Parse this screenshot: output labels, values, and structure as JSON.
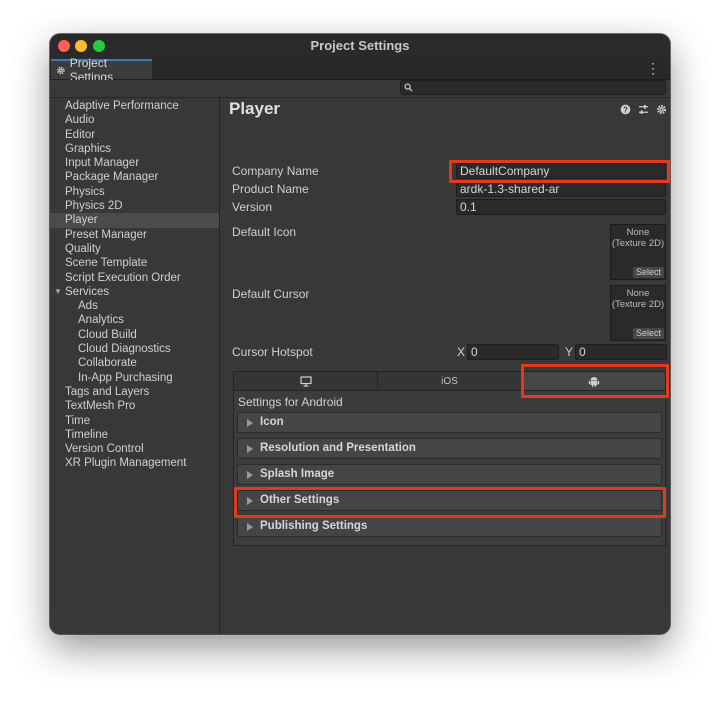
{
  "window": {
    "title": "Project Settings"
  },
  "tab": {
    "label": "Project Settings",
    "icon": "gear-icon"
  },
  "search": {
    "placeholder": "",
    "icon": "search-icon"
  },
  "sidebar": {
    "items": [
      {
        "label": "Adaptive Performance"
      },
      {
        "label": "Audio"
      },
      {
        "label": "Editor"
      },
      {
        "label": "Graphics"
      },
      {
        "label": "Input Manager"
      },
      {
        "label": "Package Manager"
      },
      {
        "label": "Physics"
      },
      {
        "label": "Physics 2D"
      },
      {
        "label": "Player"
      },
      {
        "label": "Preset Manager"
      },
      {
        "label": "Quality"
      },
      {
        "label": "Scene Template"
      },
      {
        "label": "Script Execution Order"
      },
      {
        "label": "Services"
      },
      {
        "label": "Ads"
      },
      {
        "label": "Analytics"
      },
      {
        "label": "Cloud Build"
      },
      {
        "label": "Cloud Diagnostics"
      },
      {
        "label": "Collaborate"
      },
      {
        "label": "In-App Purchasing"
      },
      {
        "label": "Tags and Layers"
      },
      {
        "label": "TextMesh Pro"
      },
      {
        "label": "Time"
      },
      {
        "label": "Timeline"
      },
      {
        "label": "Version Control"
      },
      {
        "label": "XR Plugin Management"
      }
    ],
    "selected": "Player"
  },
  "player": {
    "heading": "Player",
    "header_icons": [
      "help-icon",
      "sliders-icon",
      "gear-icon"
    ],
    "company_name_label": "Company Name",
    "company_name_value": "DefaultCompany",
    "product_name_label": "Product Name",
    "product_name_value": "ardk-1.3-shared-ar",
    "version_label": "Version",
    "version_value": "0.1",
    "default_icon_label": "Default Icon",
    "default_icon_slot": "None\n(Texture 2D)",
    "default_cursor_label": "Default Cursor",
    "default_cursor_slot": "None\n(Texture 2D)",
    "select_label": "Select",
    "cursor_hotspot_label": "Cursor Hotspot",
    "hotspot_x_label": "X",
    "hotspot_x_value": "0",
    "hotspot_y_label": "Y",
    "hotspot_y_value": "0"
  },
  "platform_tabs": [
    {
      "icon": "monitor-icon",
      "label": ""
    },
    {
      "icon": "",
      "label": "iOS"
    },
    {
      "icon": "android-icon",
      "label": ""
    }
  ],
  "platform_panel": {
    "title": "Settings for Android",
    "sections": [
      {
        "label": "Icon"
      },
      {
        "label": "Resolution and Presentation"
      },
      {
        "label": "Splash Image"
      },
      {
        "label": "Other Settings"
      },
      {
        "label": "Publishing Settings"
      }
    ]
  },
  "highlight_color": "#e3391f"
}
